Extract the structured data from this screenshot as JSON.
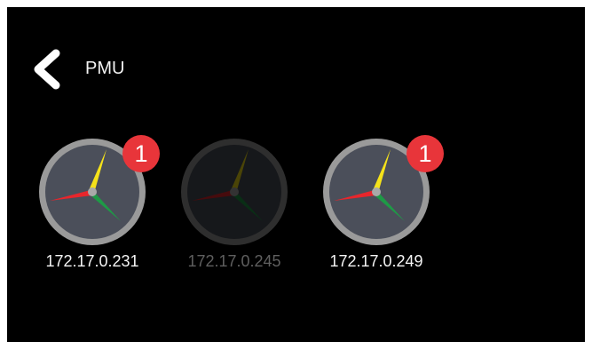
{
  "header": {
    "back_icon": "chevron-left-icon",
    "title": "PMU"
  },
  "devices": [
    {
      "ip": "172.17.0.231",
      "icon": "clock-gauge-icon",
      "badge": "1",
      "active": true
    },
    {
      "ip": "172.17.0.245",
      "icon": "clock-gauge-icon",
      "badge": null,
      "active": false
    },
    {
      "ip": "172.17.0.249",
      "icon": "clock-gauge-icon",
      "badge": "1",
      "active": true
    }
  ],
  "colors": {
    "background": "#000000",
    "gauge_ring": "#9a9a9a",
    "gauge_face": "#4b4f5a",
    "hand_up": "#f5e21a",
    "hand_left": "#e8262c",
    "hand_right": "#1e9a46",
    "badge": "#e8353a"
  }
}
